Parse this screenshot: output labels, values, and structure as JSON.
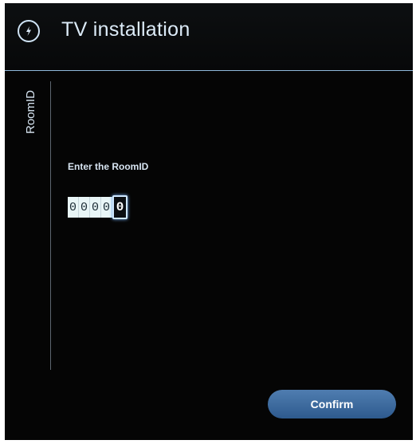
{
  "header": {
    "title": "TV installation",
    "icon": "power-bolt-icon"
  },
  "side_tab": {
    "label": "RoomID"
  },
  "form": {
    "prompt": "Enter the RoomID",
    "digits": [
      "0",
      "0",
      "0",
      "0",
      "0"
    ],
    "active_index": 4
  },
  "actions": {
    "confirm_label": "Confirm"
  },
  "colors": {
    "background": "#050505",
    "accent": "#4f7db0",
    "divider": "#8fb8dc"
  }
}
